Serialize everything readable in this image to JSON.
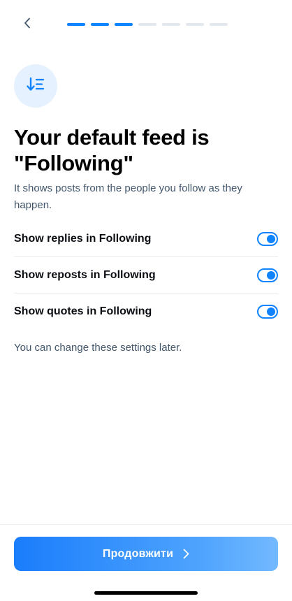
{
  "header": {
    "back_icon": "chevron-left-icon",
    "progress": {
      "total_steps": 7,
      "completed_steps": 3
    }
  },
  "hero_icon": "sort-descending-list-icon",
  "title": "Your default feed is \"Following\"",
  "subtitle": "It shows posts from the people you follow as they happen.",
  "settings": [
    {
      "label": "Show replies in Following",
      "enabled": true
    },
    {
      "label": "Show reposts in Following",
      "enabled": true
    },
    {
      "label": "Show quotes in Following",
      "enabled": true
    }
  ],
  "hint": "You can change these settings later.",
  "footer": {
    "continue_label": "Продовжити",
    "continue_icon": "chevron-right-icon"
  },
  "colors": {
    "accent": "#1083fe",
    "icon_bg": "#e6f1ff",
    "muted_text": "#42576c"
  }
}
